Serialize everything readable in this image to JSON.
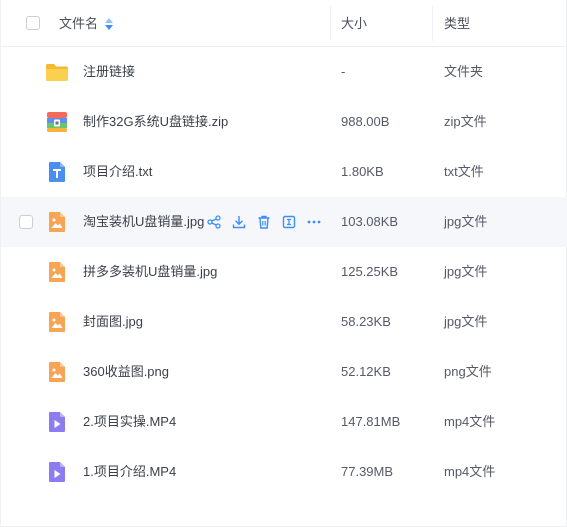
{
  "header": {
    "name_label": "文件名",
    "size_label": "大小",
    "type_label": "类型"
  },
  "rows": [
    {
      "icon": "folder-icon",
      "name": "注册链接",
      "size": "-",
      "type": "文件夹"
    },
    {
      "icon": "zip-file-icon",
      "name": "制作32G系统U盘链接.zip",
      "size": "988.00B",
      "type": "zip文件"
    },
    {
      "icon": "txt-file-icon",
      "name": "项目介绍.txt",
      "size": "1.80KB",
      "type": "txt文件"
    },
    {
      "icon": "image-file-icon",
      "name": "淘宝装机U盘销量.jpg",
      "size": "103.08KB",
      "type": "jpg文件"
    },
    {
      "icon": "image-file-icon",
      "name": "拼多多装机U盘销量.jpg",
      "size": "125.25KB",
      "type": "jpg文件"
    },
    {
      "icon": "image-file-icon",
      "name": "封面图.jpg",
      "size": "58.23KB",
      "type": "jpg文件"
    },
    {
      "icon": "image-file-icon",
      "name": "360收益图.png",
      "size": "52.12KB",
      "type": "png文件"
    },
    {
      "icon": "video-file-icon",
      "name": "2.项目实操.MP4",
      "size": "147.81MB",
      "type": "mp4文件"
    },
    {
      "icon": "video-file-icon",
      "name": "1.项目介绍.MP4",
      "size": "77.39MB",
      "type": "mp4文件"
    }
  ],
  "hover_actions": [
    "share-icon",
    "download-icon",
    "delete-icon",
    "rename-icon",
    "more-icon"
  ],
  "colors": {
    "accent": "#3d8ef5",
    "folder": "#f8c944",
    "image": "#f7a454",
    "video": "#8c7cf0",
    "txt": "#4a8ff0"
  }
}
